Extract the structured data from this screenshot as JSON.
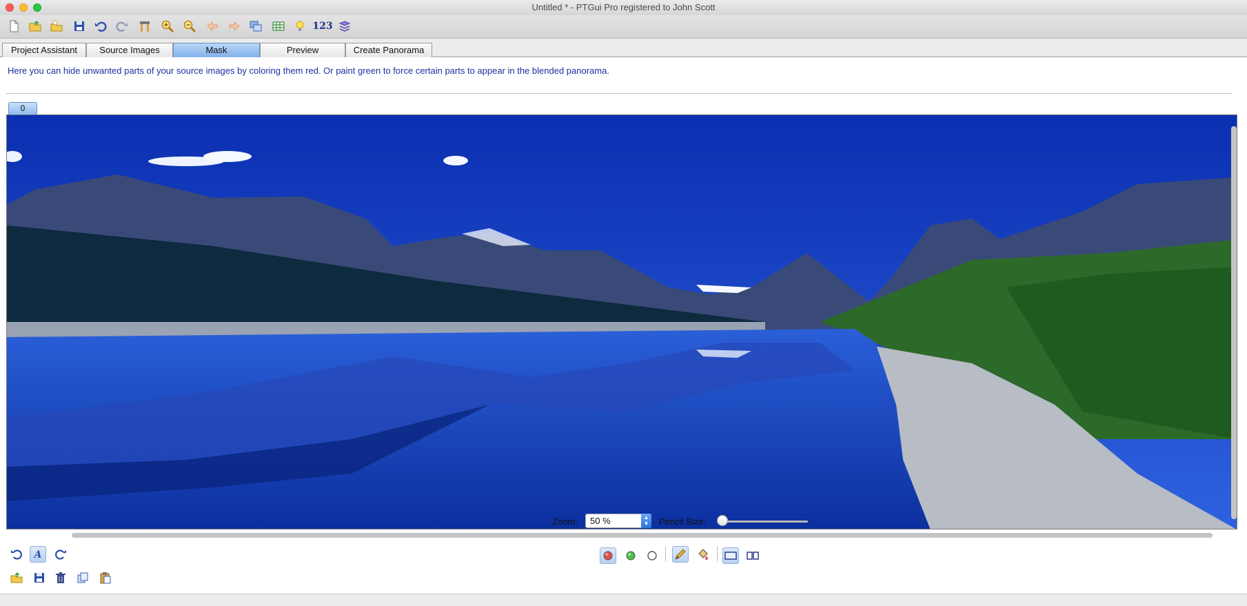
{
  "window": {
    "title": "Untitled * - PTGui Pro registered to John Scott"
  },
  "toolbar": {
    "items": [
      {
        "icon": "new-file-icon"
      },
      {
        "icon": "open-folder-icon"
      },
      {
        "icon": "open-recent-icon"
      },
      {
        "icon": "save-icon"
      },
      {
        "icon": "undo-icon"
      },
      {
        "icon": "redo-icon"
      },
      {
        "icon": "tools-icon"
      },
      {
        "icon": "zoom-in-icon"
      },
      {
        "icon": "zoom-out-icon"
      },
      {
        "icon": "arrow-left-icon"
      },
      {
        "icon": "arrow-right-icon"
      },
      {
        "icon": "panorama-editor-icon"
      },
      {
        "icon": "table-icon"
      },
      {
        "icon": "lightbulb-icon"
      },
      {
        "icon": "numbers-icon"
      },
      {
        "icon": "batch-stitcher-icon"
      }
    ],
    "numbers_label": "123"
  },
  "tabs": [
    {
      "label": "Project Assistant",
      "active": false
    },
    {
      "label": "Source Images",
      "active": false
    },
    {
      "label": "Mask",
      "active": true
    },
    {
      "label": "Preview",
      "active": false
    },
    {
      "label": "Create Panorama",
      "active": false
    }
  ],
  "content": {
    "hint": "Here you can hide unwanted parts of your source images by coloring them red. Or paint green to force certain parts to appear in the blended panorama.",
    "image_tab_label": "0"
  },
  "mask_tools": {
    "left_row1": [
      "rotate-left-icon",
      "auto-mask-icon",
      "rotate-right-icon"
    ],
    "left_row2": [
      "load-mask-icon",
      "save-mask-icon",
      "delete-mask-icon",
      "copy-mask-icon",
      "paste-mask-icon"
    ],
    "colors": [
      "red-mask-color-icon",
      "green-mask-color-icon",
      "clear-mask-color-icon"
    ],
    "draw_tools": [
      "pencil-icon",
      "fill-bucket-icon"
    ],
    "views": [
      "single-view-icon",
      "split-view-icon"
    ]
  },
  "zoom": {
    "label": "Zoom:",
    "value": "50 %"
  },
  "pencil": {
    "label": "Pencil Size:",
    "level": 0.06
  },
  "colors": {
    "accent": "#3b7de0",
    "hint_text": "#1b2fa0",
    "red_mask": "#d9534f",
    "green_mask": "#4cbf4c"
  }
}
